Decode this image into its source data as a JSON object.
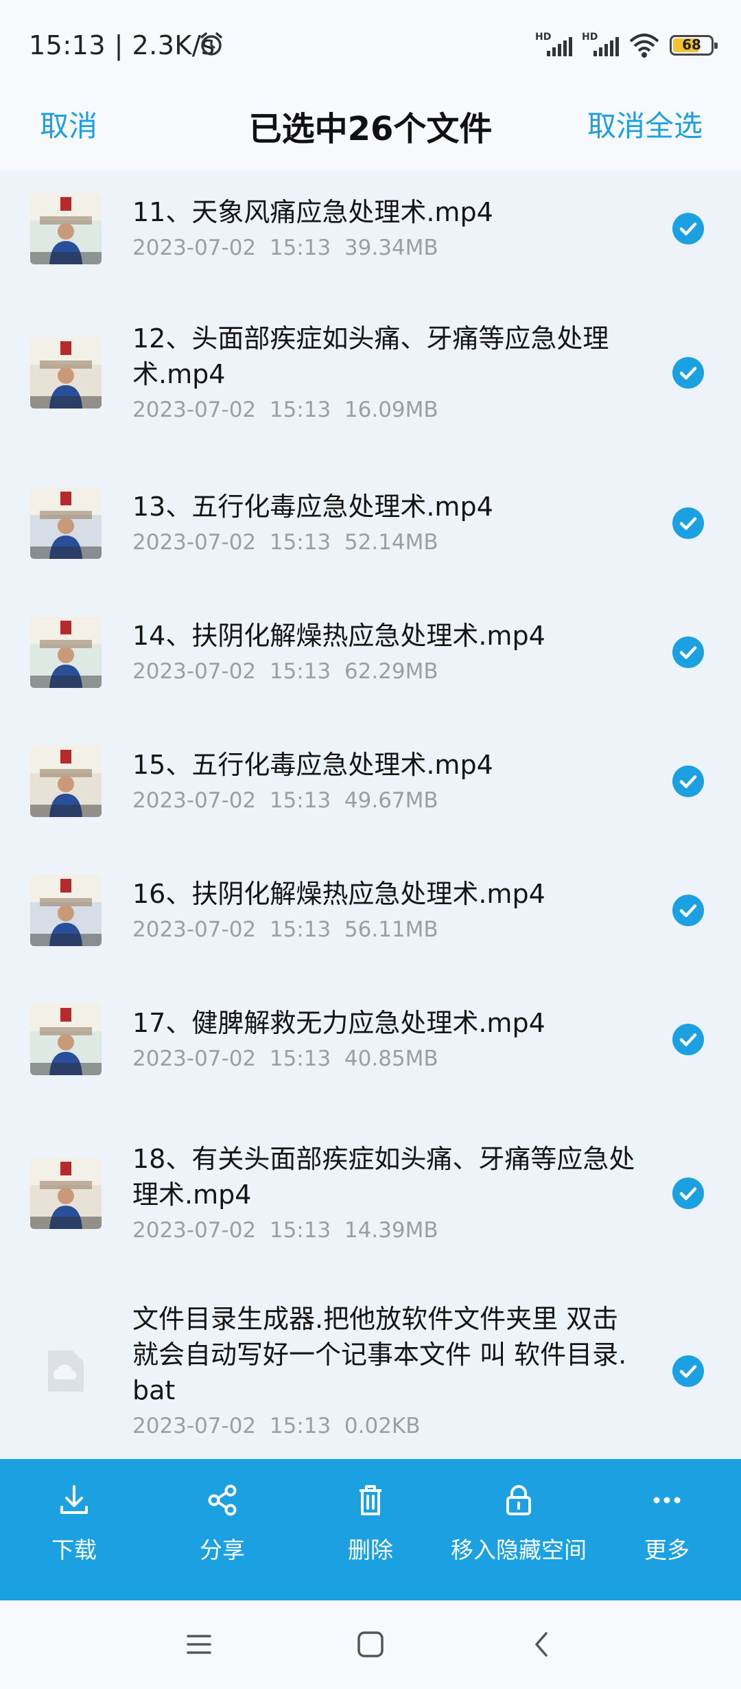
{
  "status": {
    "time": "15:13 | 2.3K/s",
    "hd1": "HD",
    "hd2": "HD",
    "battery": "68",
    "icons": [
      "alarm-icon",
      "signal-icon",
      "signal-icon",
      "wifi-icon",
      "battery-icon"
    ]
  },
  "header": {
    "cancel": "取消",
    "title": "已选中26个文件",
    "deselect_all": "取消全选"
  },
  "files": [
    {
      "name": "11、天象风痛应急处理术.mp4",
      "meta": "2023-07-02  15:13  39.34MB",
      "checked": true,
      "thumb": "video-thumb"
    },
    {
      "name": "12、头面部疾症如头痛、牙痛等应急处理术.mp4",
      "meta": "2023-07-02  15:13  16.09MB",
      "checked": true,
      "thumb": "video-thumb"
    },
    {
      "name": "13、五行化毒应急处理术.mp4",
      "meta": "2023-07-02  15:13  52.14MB",
      "checked": true,
      "thumb": "video-thumb"
    },
    {
      "name": "14、扶阴化解燥热应急处理术.mp4",
      "meta": "2023-07-02  15:13  62.29MB",
      "checked": true,
      "thumb": "video-thumb"
    },
    {
      "name": "15、五行化毒应急处理术.mp4",
      "meta": "2023-07-02  15:13  49.67MB",
      "checked": true,
      "thumb": "video-thumb"
    },
    {
      "name": "16、扶阴化解燥热应急处理术.mp4",
      "meta": "2023-07-02  15:13  56.11MB",
      "checked": true,
      "thumb": "video-thumb"
    },
    {
      "name": "17、健脾解救无力应急处理术.mp4",
      "meta": "2023-07-02  15:13  40.85MB",
      "checked": true,
      "thumb": "video-thumb"
    },
    {
      "name": "18、有关头面部疾症如头痛、牙痛等应急处理术.mp4",
      "meta": "2023-07-02  15:13  14.39MB",
      "checked": true,
      "thumb": "video-thumb"
    },
    {
      "name": "文件目录生成器.把他放软件文件夹里 双击 就会自动写好一个记事本文件 叫 软件目录.bat",
      "meta": "2023-07-02  15:13  0.02KB",
      "checked": true,
      "thumb": "file-icon"
    }
  ],
  "actions": [
    {
      "label": "下载",
      "icon": "download-icon"
    },
    {
      "label": "分享",
      "icon": "share-icon"
    },
    {
      "label": "删除",
      "icon": "trash-icon"
    },
    {
      "label": "移入隐藏空间",
      "icon": "lock-icon"
    },
    {
      "label": "更多",
      "icon": "more-icon"
    }
  ],
  "colors": {
    "accent": "#1ba0e2",
    "background": "#eef3fa",
    "meta_text": "#9a9ea5"
  }
}
